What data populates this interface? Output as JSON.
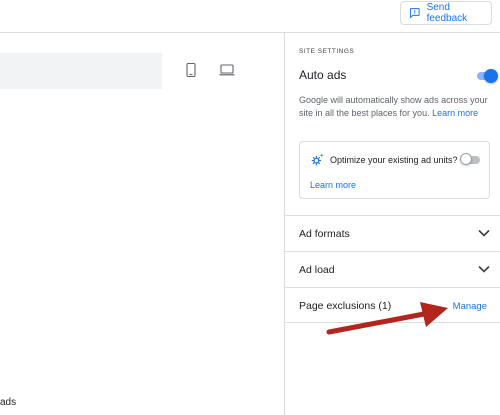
{
  "header": {
    "feedback_label": "Send feedback",
    "feedback_icon": "feedback-icon"
  },
  "preview": {
    "devices": [
      "phone-icon",
      "laptop-icon"
    ],
    "bottom_text": "ads"
  },
  "settings": {
    "section_title": "SITE SETTINGS",
    "auto_ads": {
      "label": "Auto ads",
      "enabled": true
    },
    "description": "Google will automatically show ads across your site in all the best places for you.",
    "learn_more": "Learn more",
    "optimize": {
      "label": "Optimize your existing ad units?",
      "enabled": false,
      "learn_more": "Learn more",
      "icon": "gear-sparkle-icon"
    },
    "rows": [
      {
        "label": "Ad formats",
        "icon": "chevron-down-icon"
      },
      {
        "label": "Ad load",
        "icon": "chevron-down-icon"
      },
      {
        "label": "Page exclusions (1)",
        "action": "Manage"
      }
    ]
  },
  "colors": {
    "accent": "#1a73e8",
    "annotation_arrow": "#b3261e"
  }
}
